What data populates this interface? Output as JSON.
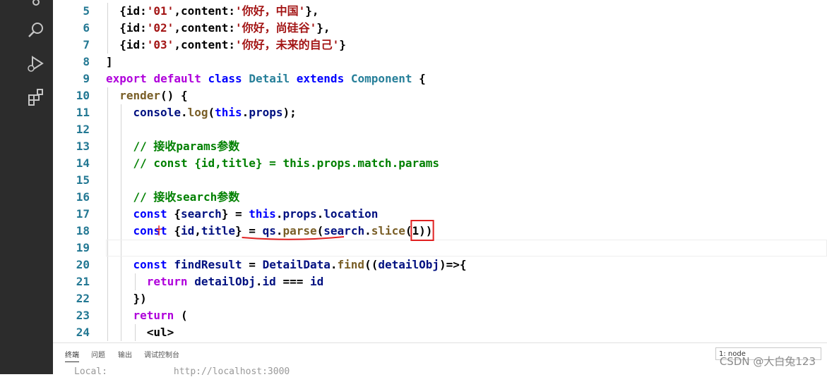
{
  "activity_bar": {
    "icons": [
      "source-control-icon",
      "search-icon",
      "run-debug-icon",
      "extensions-icon"
    ]
  },
  "editor": {
    "lines": [
      {
        "num": "5",
        "tokens": [
          {
            "t": "{id:",
            "c": ""
          },
          {
            "t": "'01'",
            "c": "str"
          },
          {
            "t": ",content:",
            "c": ""
          },
          {
            "t": "'你好，中国'",
            "c": "str"
          },
          {
            "t": "},",
            "c": ""
          }
        ]
      },
      {
        "num": "6",
        "tokens": [
          {
            "t": "{id:",
            "c": ""
          },
          {
            "t": "'02'",
            "c": "str"
          },
          {
            "t": ",content:",
            "c": ""
          },
          {
            "t": "'你好，尚硅谷'",
            "c": "str"
          },
          {
            "t": "},",
            "c": ""
          }
        ]
      },
      {
        "num": "7",
        "tokens": [
          {
            "t": "{id:",
            "c": ""
          },
          {
            "t": "'03'",
            "c": "str"
          },
          {
            "t": ",content:",
            "c": ""
          },
          {
            "t": "'你好，未来的自己'",
            "c": "str"
          },
          {
            "t": "}",
            "c": ""
          }
        ]
      },
      {
        "num": "8",
        "tokens": [
          {
            "t": "]",
            "c": ""
          }
        ]
      },
      {
        "num": "9",
        "tokens": [
          {
            "t": "export",
            "c": "kw2"
          },
          {
            "t": " ",
            "c": ""
          },
          {
            "t": "default",
            "c": "kw2"
          },
          {
            "t": " ",
            "c": ""
          },
          {
            "t": "class",
            "c": "kw"
          },
          {
            "t": " ",
            "c": ""
          },
          {
            "t": "Detail",
            "c": "cls"
          },
          {
            "t": " ",
            "c": ""
          },
          {
            "t": "extends",
            "c": "kw"
          },
          {
            "t": " ",
            "c": ""
          },
          {
            "t": "Component",
            "c": "cls"
          },
          {
            "t": " {",
            "c": ""
          }
        ]
      },
      {
        "num": "10",
        "tokens": [
          {
            "t": "render",
            "c": "fn"
          },
          {
            "t": "() {",
            "c": ""
          }
        ]
      },
      {
        "num": "11",
        "tokens": [
          {
            "t": "console",
            "c": "var"
          },
          {
            "t": ".",
            "c": ""
          },
          {
            "t": "log",
            "c": "fn"
          },
          {
            "t": "(",
            "c": ""
          },
          {
            "t": "this",
            "c": "kw"
          },
          {
            "t": ".",
            "c": ""
          },
          {
            "t": "props",
            "c": "var"
          },
          {
            "t": ");",
            "c": ""
          }
        ]
      },
      {
        "num": "12",
        "tokens": []
      },
      {
        "num": "13",
        "tokens": [
          {
            "t": "// 接收params参数",
            "c": "cmt"
          }
        ]
      },
      {
        "num": "14",
        "tokens": [
          {
            "t": "// const {id,title} = this.props.match.params",
            "c": "cmt"
          }
        ]
      },
      {
        "num": "15",
        "tokens": []
      },
      {
        "num": "16",
        "tokens": [
          {
            "t": "// 接收search参数",
            "c": "cmt"
          }
        ]
      },
      {
        "num": "17",
        "tokens": [
          {
            "t": "const",
            "c": "kw"
          },
          {
            "t": " {",
            "c": ""
          },
          {
            "t": "search",
            "c": "var"
          },
          {
            "t": "} = ",
            "c": ""
          },
          {
            "t": "this",
            "c": "kw"
          },
          {
            "t": ".",
            "c": ""
          },
          {
            "t": "props",
            "c": "var"
          },
          {
            "t": ".",
            "c": ""
          },
          {
            "t": "location",
            "c": "var"
          }
        ]
      },
      {
        "num": "18",
        "tokens": [
          {
            "t": "const",
            "c": "kw"
          },
          {
            "t": " {",
            "c": ""
          },
          {
            "t": "id",
            "c": "var"
          },
          {
            "t": ",",
            "c": ""
          },
          {
            "t": "title",
            "c": "var"
          },
          {
            "t": "} = ",
            "c": ""
          },
          {
            "t": "qs",
            "c": "var"
          },
          {
            "t": ".",
            "c": ""
          },
          {
            "t": "parse",
            "c": "fn"
          },
          {
            "t": "(",
            "c": ""
          },
          {
            "t": "search",
            "c": "var"
          },
          {
            "t": ".",
            "c": ""
          },
          {
            "t": "slice",
            "c": "fn"
          },
          {
            "t": "(1))",
            "c": ""
          }
        ]
      },
      {
        "num": "19",
        "tokens": []
      },
      {
        "num": "20",
        "tokens": [
          {
            "t": "const",
            "c": "kw"
          },
          {
            "t": " ",
            "c": ""
          },
          {
            "t": "findResult",
            "c": "var"
          },
          {
            "t": " = ",
            "c": ""
          },
          {
            "t": "DetailData",
            "c": "var"
          },
          {
            "t": ".",
            "c": ""
          },
          {
            "t": "find",
            "c": "fn"
          },
          {
            "t": "((",
            "c": ""
          },
          {
            "t": "detailObj",
            "c": "var"
          },
          {
            "t": ")=>{",
            "c": ""
          }
        ]
      },
      {
        "num": "21",
        "tokens": [
          {
            "t": "return",
            "c": "kw2"
          },
          {
            "t": " ",
            "c": ""
          },
          {
            "t": "detailObj",
            "c": "var"
          },
          {
            "t": ".",
            "c": ""
          },
          {
            "t": "id",
            "c": "var"
          },
          {
            "t": " === ",
            "c": ""
          },
          {
            "t": "id",
            "c": "var"
          }
        ]
      },
      {
        "num": "22",
        "tokens": [
          {
            "t": "})",
            "c": ""
          }
        ]
      },
      {
        "num": "23",
        "tokens": [
          {
            "t": "return",
            "c": "kw2"
          },
          {
            "t": " (",
            "c": ""
          }
        ]
      },
      {
        "num": "24",
        "tokens": [
          {
            "t": "<ul>",
            "c": ""
          }
        ]
      }
    ],
    "annotation_color": "#e02020"
  },
  "panel": {
    "tabs": [
      "终端",
      "问题",
      "输出",
      "调试控制台"
    ],
    "active_tab": "终端",
    "terminal_select": "1: node",
    "terminal_text": "Local:            http://localhost:3000"
  },
  "watermark": "CSDN @大白兔123"
}
